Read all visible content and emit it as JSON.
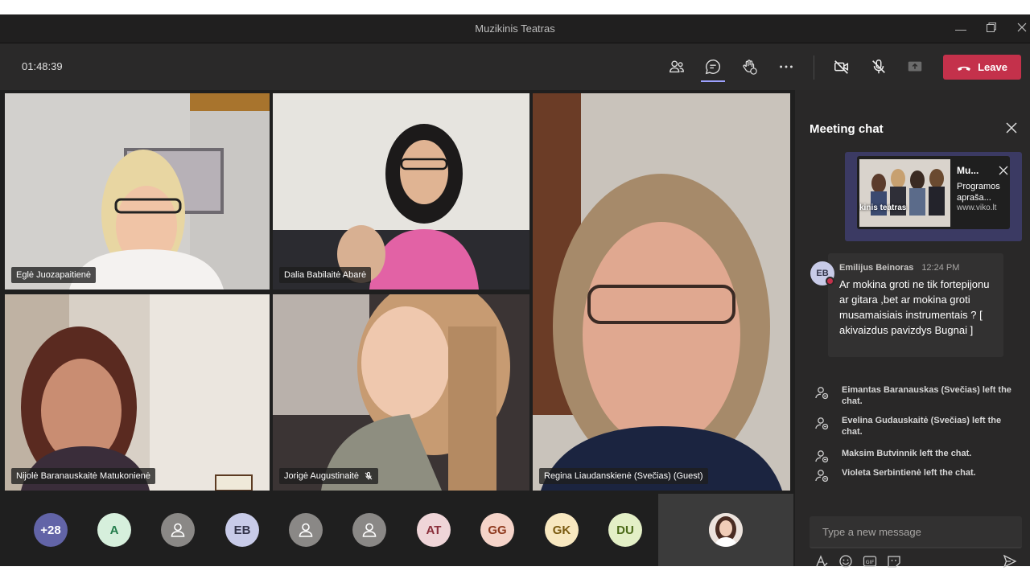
{
  "window": {
    "title": "Muzikinis Teatras"
  },
  "toolbar": {
    "timer": "01:48:39",
    "leave_label": "Leave"
  },
  "participants": [
    {
      "name": "Eglė Juozapaitienė"
    },
    {
      "name": "Dalia Babilaitė Abarė"
    },
    {
      "name": "Nijolė Baranauskaitė Matukonienė"
    },
    {
      "name": "Jorigė Augustinaitė",
      "muted": true
    },
    {
      "name": "Regina Liaudanskienė (Svečias) (Guest)"
    }
  ],
  "strip": [
    {
      "label": "+28",
      "bg": "#6264a7",
      "fg": "#ffffff"
    },
    {
      "label": "A",
      "bg": "#d6efdc",
      "fg": "#237b4b"
    },
    {
      "label": "",
      "icon": "person-icon",
      "bg": "#8a8886",
      "fg": "#ffffff"
    },
    {
      "label": "EB",
      "bg": "#c8cbe8",
      "fg": "#33344a"
    },
    {
      "label": "",
      "icon": "person-icon",
      "bg": "#8a8886",
      "fg": "#ffffff"
    },
    {
      "label": "",
      "icon": "person-icon",
      "bg": "#8a8886",
      "fg": "#ffffff"
    },
    {
      "label": "AT",
      "bg": "#efd5d8",
      "fg": "#8a2e3a"
    },
    {
      "label": "GG",
      "bg": "#f5d4c9",
      "fg": "#8f3a1f"
    },
    {
      "label": "GK",
      "bg": "#f8e8c0",
      "fg": "#7a5a10"
    },
    {
      "label": "DU",
      "bg": "#e3efc6",
      "fg": "#4b6a18"
    }
  ],
  "chat": {
    "title": "Meeting chat",
    "card": {
      "title": "Mu...",
      "description": "Programos aprašа...",
      "url": "www.viko.lt",
      "thumb_text": "kinis teatras"
    },
    "message": {
      "initials": "EB",
      "author": "Emilijus Beinoras",
      "time": "12:24 PM",
      "text": "Ar mokina groti ne tik fortepijonu ar gitara ,bet ar mokina groti musamaisiais instrumentais ? [ akivaizdus pavizdys Bugnai ]"
    },
    "events": [
      "Eimantas Baranauskas (Svečias) left the chat.",
      "Evelina Gudauskaitė (Svečias) left the chat.",
      "Maksim Butvinnik left the chat.",
      "Violeta Serbintienė left the chat."
    ],
    "compose_placeholder": "Type a new message"
  },
  "colors": {
    "leave": "#c4314b",
    "accent": "#6264a7",
    "panel": "#292828"
  }
}
